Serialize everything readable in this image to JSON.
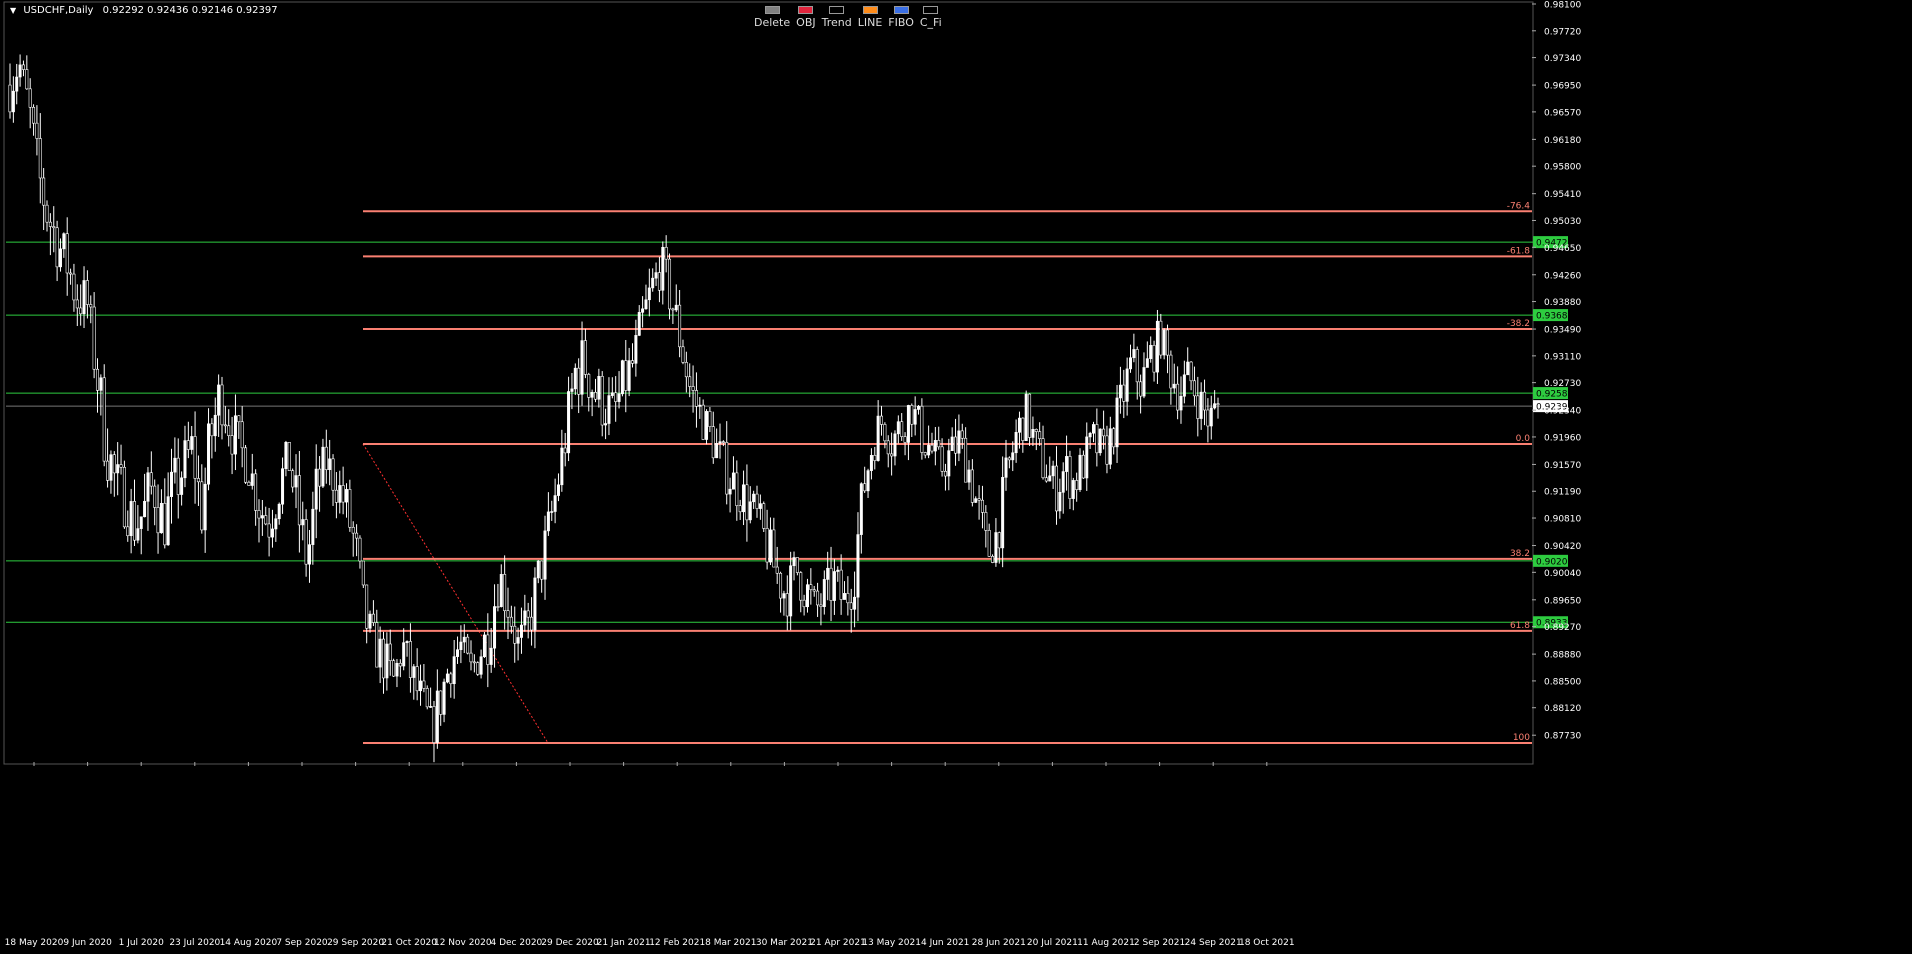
{
  "header": {
    "symbol": "USDCHF,Daily",
    "ohlc": "0.92292 0.92436 0.92146 0.92397"
  },
  "toolbar": [
    {
      "label": "Delete",
      "color": "#808080"
    },
    {
      "label": "OBJ",
      "color": "#e0243c"
    },
    {
      "label": "Trend",
      "color": "#000000"
    },
    {
      "label": "LINE",
      "color": "#ff8c1a"
    },
    {
      "label": "FIBO",
      "color": "#3a6fe6"
    },
    {
      "label": "C_Fi",
      "color": "#000000"
    }
  ],
  "chart_data": {
    "type": "candlestick",
    "symbol": "USDCHF",
    "timeframe": "Daily",
    "ylim": [
      0.8735,
      0.981
    ],
    "y_ticks": [
      "0.98100",
      "0.97720",
      "0.97340",
      "0.96950",
      "0.96570",
      "0.96180",
      "0.95800",
      "0.95410",
      "0.95030",
      "0.94650",
      "0.94260",
      "0.93880",
      "0.93490",
      "0.93110",
      "0.92730",
      "0.92340",
      "0.91960",
      "0.91570",
      "0.91190",
      "0.90810",
      "0.90420",
      "0.90040",
      "0.89650",
      "0.89270",
      "0.88880",
      "0.88500",
      "0.88120",
      "0.87730"
    ],
    "x_labels": [
      "18 May 2020",
      "9 Jun 2020",
      "1 Jul 2020",
      "23 Jul 2020",
      "14 Aug 2020",
      "7 Sep 2020",
      "29 Sep 2020",
      "21 Oct 2020",
      "12 Nov 2020",
      "4 Dec 2020",
      "29 Dec 2020",
      "21 Jan 2021",
      "12 Feb 2021",
      "8 Mar 2021",
      "30 Mar 2021",
      "21 Apr 2021",
      "13 May 2021",
      "4 Jun 2021",
      "28 Jun 2021",
      "20 Jul 2021",
      "11 Aug 2021",
      "2 Sep 2021",
      "24 Sep 2021",
      "18 Oct 2021"
    ],
    "price_path": [
      [
        0.9695,
        0.9735,
        0.964
      ],
      [
        0.9725,
        0.975,
        0.969
      ],
      [
        0.966,
        0.97,
        0.961
      ],
      [
        0.9565,
        0.961,
        0.95
      ],
      [
        0.951,
        0.955,
        0.942
      ],
      [
        0.947,
        0.952,
        0.942
      ],
      [
        0.944,
        0.948,
        0.938
      ],
      [
        0.9395,
        0.947,
        0.935
      ],
      [
        0.939,
        0.944,
        0.936
      ],
      [
        0.929,
        0.934,
        0.923
      ],
      [
        0.919,
        0.924,
        0.91
      ],
      [
        0.913,
        0.918,
        0.908
      ],
      [
        0.911,
        0.917,
        0.906
      ],
      [
        0.907,
        0.912,
        0.902
      ],
      [
        0.909,
        0.915,
        0.903
      ],
      [
        0.913,
        0.919,
        0.906
      ],
      [
        0.907,
        0.911,
        0.9
      ],
      [
        0.912,
        0.917,
        0.906
      ],
      [
        0.915,
        0.92,
        0.909
      ],
      [
        0.918,
        0.921,
        0.911
      ],
      [
        0.909,
        0.917,
        0.906
      ],
      [
        0.92,
        0.927,
        0.913
      ],
      [
        0.926,
        0.93,
        0.919
      ],
      [
        0.921,
        0.926,
        0.916
      ],
      [
        0.918,
        0.922,
        0.913
      ],
      [
        0.915,
        0.919,
        0.911
      ],
      [
        0.91,
        0.916,
        0.906
      ],
      [
        0.907,
        0.911,
        0.903
      ],
      [
        0.912,
        0.918,
        0.909
      ],
      [
        0.917,
        0.92,
        0.913
      ],
      [
        0.909,
        0.915,
        0.903
      ],
      [
        0.902,
        0.908,
        0.898
      ],
      [
        0.912,
        0.919,
        0.907
      ],
      [
        0.916,
        0.92,
        0.912
      ],
      [
        0.913,
        0.917,
        0.909
      ],
      [
        0.91,
        0.915,
        0.906
      ],
      [
        0.904,
        0.91,
        0.899
      ],
      [
        0.894,
        0.899,
        0.89
      ],
      [
        0.89,
        0.894,
        0.886
      ],
      [
        0.888,
        0.893,
        0.884
      ],
      [
        0.885,
        0.89,
        0.882
      ],
      [
        0.89,
        0.893,
        0.886
      ],
      [
        0.885,
        0.89,
        0.88
      ],
      [
        0.882,
        0.886,
        0.878
      ],
      [
        0.878,
        0.884,
        0.876
      ],
      [
        0.883,
        0.89,
        0.88
      ],
      [
        0.888,
        0.893,
        0.884
      ],
      [
        0.89,
        0.893,
        0.886
      ],
      [
        0.886,
        0.891,
        0.883
      ],
      [
        0.889,
        0.893,
        0.885
      ],
      [
        0.892,
        0.899,
        0.888
      ],
      [
        0.9,
        0.904,
        0.895
      ],
      [
        0.896,
        0.901,
        0.89
      ],
      [
        0.89,
        0.895,
        0.887
      ],
      [
        0.892,
        0.898,
        0.888
      ],
      [
        0.899,
        0.902,
        0.893
      ],
      [
        0.905,
        0.909,
        0.899
      ],
      [
        0.912,
        0.917,
        0.908
      ],
      [
        0.92,
        0.925,
        0.915
      ],
      [
        0.929,
        0.935,
        0.923
      ],
      [
        0.93,
        0.937,
        0.925
      ],
      [
        0.926,
        0.932,
        0.92
      ],
      [
        0.924,
        0.93,
        0.92
      ],
      [
        0.923,
        0.928,
        0.919
      ],
      [
        0.927,
        0.932,
        0.922
      ],
      [
        0.93,
        0.935,
        0.926
      ],
      [
        0.936,
        0.941,
        0.931
      ],
      [
        0.941,
        0.944,
        0.937
      ],
      [
        0.944,
        0.9475,
        0.94
      ],
      [
        0.939,
        0.945,
        0.935
      ],
      [
        0.933,
        0.938,
        0.928
      ],
      [
        0.926,
        0.931,
        0.921
      ],
      [
        0.923,
        0.927,
        0.919
      ],
      [
        0.92,
        0.925,
        0.917
      ],
      [
        0.917,
        0.921,
        0.913
      ],
      [
        0.914,
        0.919,
        0.91
      ],
      [
        0.912,
        0.916,
        0.908
      ],
      [
        0.91,
        0.915,
        0.906
      ],
      [
        0.908,
        0.912,
        0.904
      ],
      [
        0.904,
        0.909,
        0.9
      ],
      [
        0.9,
        0.906,
        0.896
      ],
      [
        0.897,
        0.902,
        0.894
      ],
      [
        0.901,
        0.906,
        0.897
      ],
      [
        0.898,
        0.903,
        0.893
      ],
      [
        0.895,
        0.9,
        0.892
      ],
      [
        0.897,
        0.903,
        0.894
      ],
      [
        0.899,
        0.904,
        0.895
      ],
      [
        0.896,
        0.901,
        0.893
      ],
      [
        0.9,
        0.907,
        0.896
      ],
      [
        0.912,
        0.917,
        0.907
      ],
      [
        0.919,
        0.924,
        0.915
      ],
      [
        0.922,
        0.925,
        0.918
      ],
      [
        0.919,
        0.924,
        0.915
      ],
      [
        0.921,
        0.926,
        0.917
      ],
      [
        0.924,
        0.927,
        0.92
      ],
      [
        0.92,
        0.925,
        0.916
      ],
      [
        0.918,
        0.922,
        0.914
      ],
      [
        0.915,
        0.919,
        0.911
      ],
      [
        0.917,
        0.921,
        0.914
      ],
      [
        0.919,
        0.923,
        0.915
      ],
      [
        0.915,
        0.919,
        0.911
      ],
      [
        0.909,
        0.915,
        0.905
      ],
      [
        0.903,
        0.908,
        0.901
      ],
      [
        0.906,
        0.911,
        0.902
      ],
      [
        0.914,
        0.92,
        0.91
      ],
      [
        0.92,
        0.924,
        0.916
      ],
      [
        0.923,
        0.926,
        0.919
      ],
      [
        0.918,
        0.923,
        0.914
      ],
      [
        0.915,
        0.919,
        0.911
      ],
      [
        0.912,
        0.917,
        0.908
      ],
      [
        0.915,
        0.92,
        0.911
      ],
      [
        0.913,
        0.918,
        0.91
      ],
      [
        0.916,
        0.92,
        0.912
      ],
      [
        0.919,
        0.923,
        0.915
      ],
      [
        0.917,
        0.922,
        0.913
      ],
      [
        0.92,
        0.924,
        0.917
      ],
      [
        0.925,
        0.93,
        0.921
      ],
      [
        0.93,
        0.935,
        0.926
      ],
      [
        0.927,
        0.931,
        0.923
      ],
      [
        0.931,
        0.936,
        0.927
      ],
      [
        0.934,
        0.937,
        0.93
      ],
      [
        0.929,
        0.934,
        0.926
      ],
      [
        0.926,
        0.931,
        0.922
      ],
      [
        0.928,
        0.932,
        0.924
      ],
      [
        0.925,
        0.929,
        0.921
      ],
      [
        0.922,
        0.926,
        0.919
      ],
      [
        0.924,
        0.927,
        0.921
      ]
    ],
    "last_price": 0.92397,
    "green_levels": [
      {
        "price": 0.94723,
        "label": "0.94723"
      },
      {
        "price": 0.93688,
        "label": "0.93688"
      },
      {
        "price": 0.92582,
        "label": "0.92582"
      },
      {
        "price": 0.90203,
        "label": "0.90203"
      },
      {
        "price": 0.89332,
        "label": "0.89332"
      }
    ],
    "fibo_levels": [
      {
        "price": 0.9516,
        "label": "-76.4"
      },
      {
        "price": 0.9452,
        "label": "-61.8"
      },
      {
        "price": 0.9349,
        "label": "-38.2"
      },
      {
        "price": 0.9186,
        "label": "0.0"
      },
      {
        "price": 0.9023,
        "label": "38.2"
      },
      {
        "price": 0.8921,
        "label": "61.8"
      },
      {
        "price": 0.8762,
        "label": "100"
      }
    ],
    "colors": {
      "up": "#ffffff",
      "down": "#000000",
      "wick": "#ffffff",
      "green": "#2ecc40",
      "fibo": "#fa8072",
      "grid_text": "#ffffff"
    }
  }
}
